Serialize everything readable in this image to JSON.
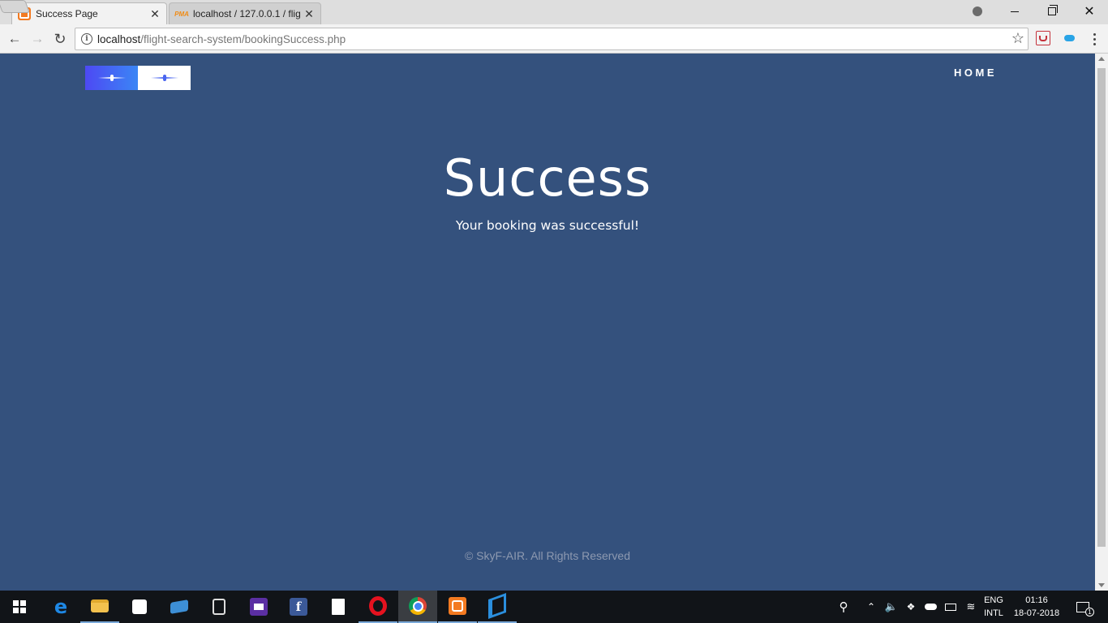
{
  "browser": {
    "tabs": [
      {
        "title": "Success Page",
        "favicon": "xampp-icon",
        "active": true
      },
      {
        "title": "localhost / 127.0.0.1 / flig",
        "favicon": "phpmyadmin-icon",
        "active": false
      }
    ],
    "tab_close_glyph": "✕",
    "pma_favicon_text": "PMA",
    "url_host": "localhost",
    "url_path": "/flight-search-system/bookingSuccess.php",
    "window_controls": {
      "minimize": "minimize",
      "restore": "restore",
      "close": "✕"
    }
  },
  "page": {
    "background_color": "#34517d",
    "nav": {
      "home_label": "HOME"
    },
    "title": "Success",
    "message": "Your booking was successful!",
    "footer": "© SkyF-AIR. All Rights Reserved"
  },
  "taskbar": {
    "pinned": [
      "start",
      "edge",
      "file-explorer",
      "store",
      "this-pc",
      "calculator",
      "mail",
      "facebook",
      "notepad",
      "opera",
      "chrome",
      "xampp",
      "vscode"
    ],
    "active_app": "chrome",
    "language": {
      "line1": "ENG",
      "line2": "INTL"
    },
    "clock": {
      "time": "01:16",
      "date": "18-07-2018"
    },
    "notification_count": "1"
  }
}
